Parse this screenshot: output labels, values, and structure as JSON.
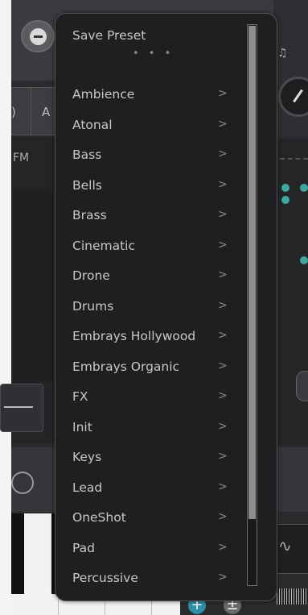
{
  "menu": {
    "save_preset": "Save Preset",
    "ellipsis": "• • •",
    "chevron": ">",
    "items": [
      "Ambience",
      "Atonal",
      "Bass",
      "Bells",
      "Brass",
      "Cinematic",
      "Drone",
      "Drums",
      "Embrays Hollywood",
      "Embrays Organic",
      "FX",
      "Init",
      "Keys",
      "Lead",
      "OneShot",
      "Pad",
      "Percussive"
    ],
    "scroll_visible_fraction": 0.88
  },
  "background": {
    "tab_partial_label": "A",
    "fm_label": "FM",
    "note_label": "A",
    "add_symbol": "+",
    "plusminus_symbol": "±"
  },
  "colors": {
    "accent": "#2e8fa6",
    "teal_dot": "#3fa6a0",
    "menu_bg": "#1f1f21"
  }
}
